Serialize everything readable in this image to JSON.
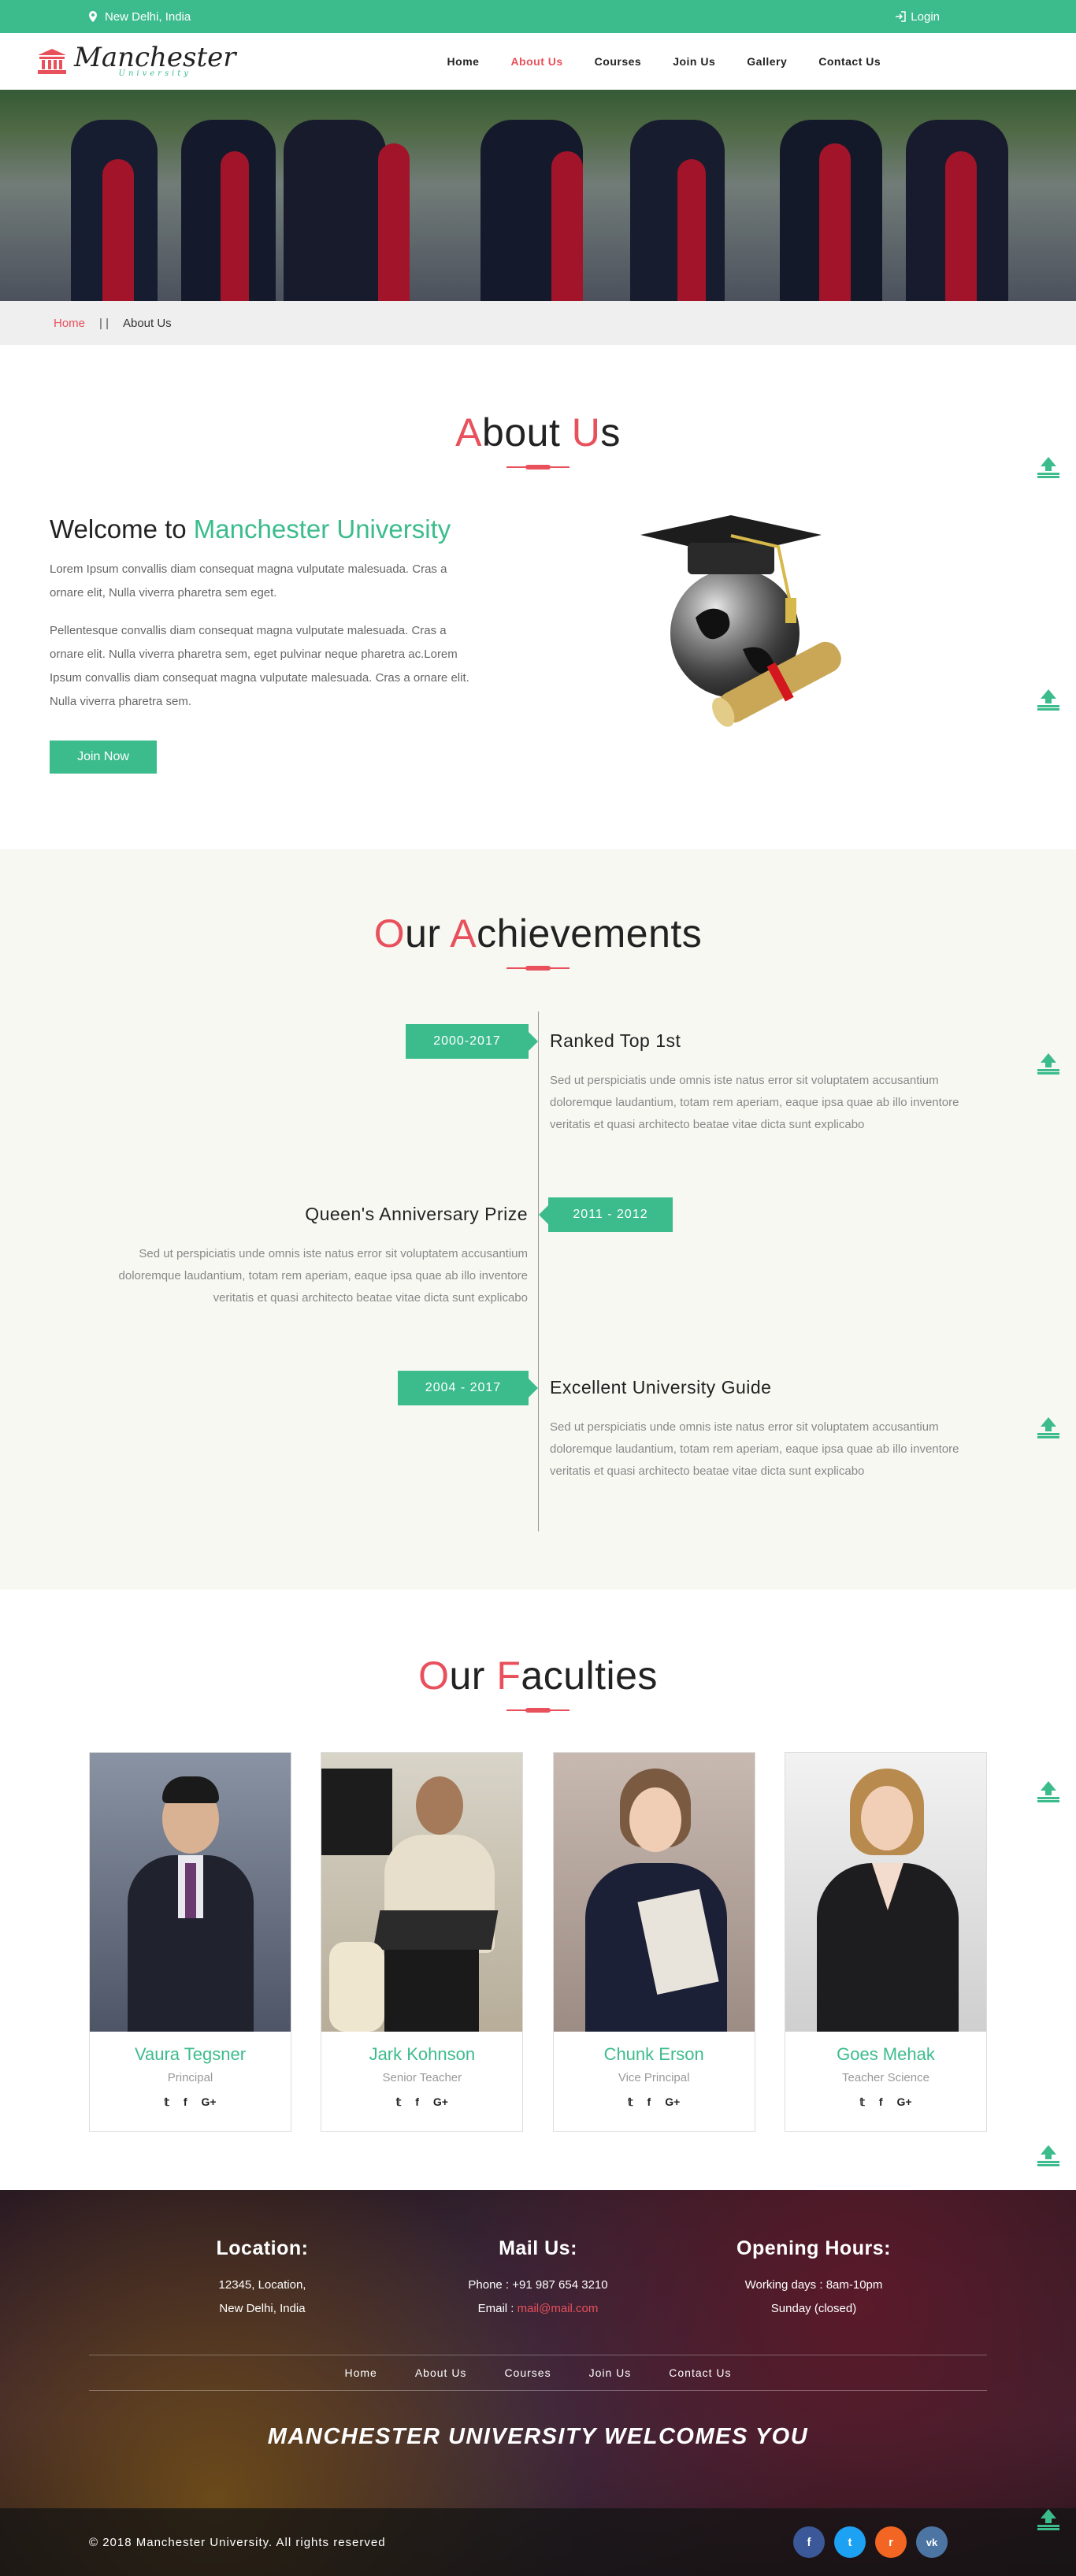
{
  "topbar": {
    "location": "New Delhi, India",
    "login": "Login"
  },
  "logo": {
    "title": "Manchester",
    "subtitle": "University"
  },
  "nav": [
    {
      "label": "Home",
      "active": false
    },
    {
      "label": "About Us",
      "active": true
    },
    {
      "label": "Courses",
      "active": false
    },
    {
      "label": "Join Us",
      "active": false
    },
    {
      "label": "Gallery",
      "active": false
    },
    {
      "label": "Contact Us",
      "active": false
    }
  ],
  "breadcrumb": {
    "home": "Home",
    "separator": "| |",
    "current": "About Us"
  },
  "about": {
    "title_cap1": "A",
    "title_rest1": "bout ",
    "title_cap2": "U",
    "title_rest2": "s",
    "heading_plain": "Welcome to ",
    "heading_accent": "Manchester University",
    "para1": "Lorem Ipsum convallis diam consequat magna vulputate malesuada. Cras a ornare elit, Nulla viverra pharetra sem eget.",
    "para2": "Pellentesque convallis diam consequat magna vulputate malesuada. Cras a ornare elit. Nulla viverra pharetra sem, eget pulvinar neque pharetra ac.Lorem Ipsum convallis diam consequat magna vulputate malesuada. Cras a ornare elit. Nulla viverra pharetra sem.",
    "button": "Join Now"
  },
  "achievements": {
    "title_cap1": "O",
    "title_rest1": "ur ",
    "title_cap2": "A",
    "title_rest2": "chievements",
    "items": [
      {
        "date": "2000-2017",
        "title": "Ranked Top 1st",
        "text": "Sed ut perspiciatis unde omnis iste natus error sit voluptatem accusantium doloremque laudantium, totam rem aperiam, eaque ipsa quae ab illo inventore veritatis et quasi architecto beatae vitae dicta sunt explicabo"
      },
      {
        "date": "2011 - 2012",
        "title": "Queen's Anniversary Prize",
        "text": "Sed ut perspiciatis unde omnis iste natus error sit voluptatem accusantium doloremque laudantium, totam rem aperiam, eaque ipsa quae ab illo inventore veritatis et quasi architecto beatae vitae dicta sunt explicabo"
      },
      {
        "date": "2004 - 2017",
        "title": "Excellent University Guide",
        "text": "Sed ut perspiciatis unde omnis iste natus error sit voluptatem accusantium doloremque laudantium, totam rem aperiam, eaque ipsa quae ab illo inventore veritatis et quasi architecto beatae vitae dicta sunt explicabo"
      }
    ]
  },
  "faculties": {
    "title_cap1": "O",
    "title_rest1": "ur ",
    "title_cap2": "F",
    "title_rest2": "aculties",
    "members": [
      {
        "name": "Vaura Tegsner",
        "role": "Principal"
      },
      {
        "name": "Jark Kohnson",
        "role": "Senior Teacher"
      },
      {
        "name": "Chunk Erson",
        "role": "Vice Principal"
      },
      {
        "name": "Goes Mehak",
        "role": "Teacher Science"
      }
    ],
    "social_labels": [
      "twitter-icon",
      "facebook-icon",
      "google-plus-icon"
    ]
  },
  "footer": {
    "location_title": "Location:",
    "location_line1": "12345, Location,",
    "location_line2": "New Delhi, India",
    "mail_title": "Mail Us:",
    "phone": "Phone : +91 987 654 3210",
    "email_label": "Email : ",
    "email": "mail@mail.com",
    "hours_title": "Opening Hours:",
    "hours_line1": "Working days : 8am-10pm",
    "hours_line2": "Sunday (closed)",
    "menu": [
      "Home",
      "About Us",
      "Courses",
      "Join Us",
      "Contact Us"
    ],
    "welcome": "MANCHESTER UNIVERSITY WELCOMES YOU",
    "copyright": "© 2018 Manchester University. All rights reserved",
    "socials": [
      {
        "icon": "facebook-icon",
        "glyph": "f",
        "color": "#3b5998"
      },
      {
        "icon": "twitter-icon",
        "glyph": "t",
        "color": "#1da1f2"
      },
      {
        "icon": "rss-icon",
        "glyph": "r",
        "color": "#f26522"
      },
      {
        "icon": "vk-icon",
        "glyph": "vk",
        "color": "#4c75a3"
      }
    ]
  },
  "colors": {
    "accent": "#3cbc8d",
    "highlight": "#e8505b"
  }
}
